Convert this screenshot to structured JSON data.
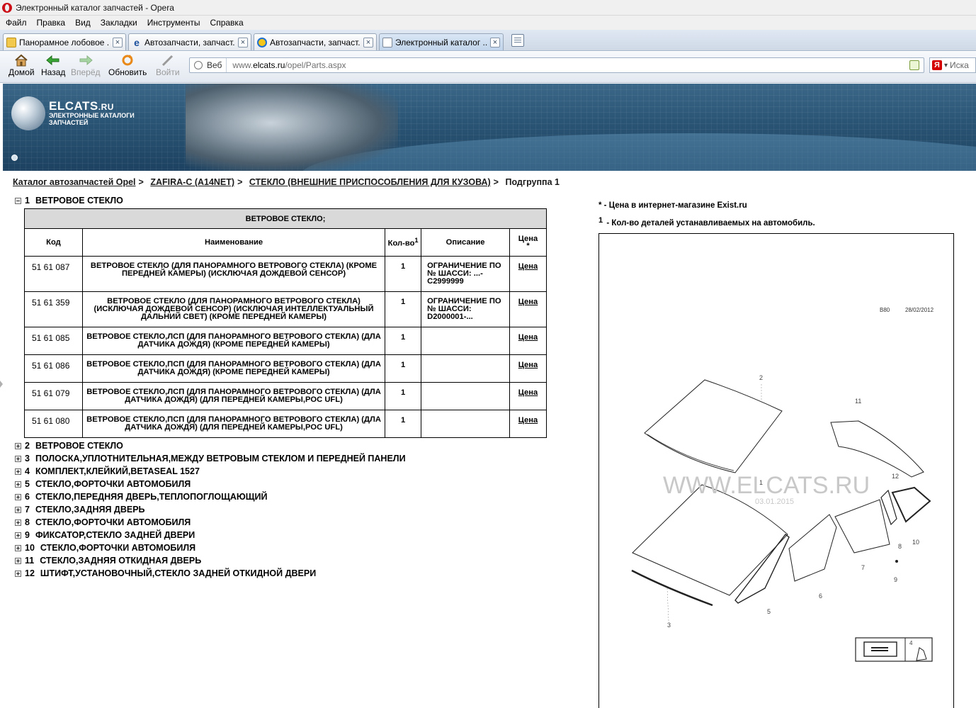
{
  "window": {
    "title": "Электронный каталог запчастей - Opera"
  },
  "menu": [
    "Файл",
    "Правка",
    "Вид",
    "Закладки",
    "Инструменты",
    "Справка"
  ],
  "tabs": [
    {
      "label": "Панорамное лобовое ...",
      "icon": "folder-icon"
    },
    {
      "label": "Автозапчасти, запчаст...",
      "icon": "ie-icon"
    },
    {
      "label": "Автозапчасти, запчаст...",
      "icon": "ie-icon"
    },
    {
      "label": "Электронный каталог ...",
      "icon": "page-icon"
    }
  ],
  "toolbar": {
    "home": "Домой",
    "back": "Назад",
    "forward": "Вперёд",
    "reload": "Обновить",
    "login": "Войти"
  },
  "address": {
    "web_label": "Веб",
    "url_prefix": "www.",
    "url_domain": "elcats.ru",
    "url_path": "/opel/Parts.aspx"
  },
  "search": {
    "placeholder": "Иска"
  },
  "banner": {
    "brand": "ELCATS",
    "brand_suffix": ".RU",
    "subtitle": "ЭЛЕКТРОННЫЕ КАТАЛОГИ ЗАПЧАСТЕЙ"
  },
  "breadcrumb": {
    "catalog": "Каталог автозапчастей Opel",
    "model": "ZAFIRA-C (A14NET)",
    "group": "СТЕКЛО (ВНЕШНИЕ ПРИСПОСОБЛЕНИЯ ДЛЯ КУЗОВА)",
    "current": "Подгруппа 1",
    "separator": ">"
  },
  "expanded_group": {
    "num": "1",
    "label": "ВЕТРОВОЕ СТЕКЛО"
  },
  "table": {
    "caption": "ВЕТРОВОЕ СТЕКЛО;",
    "headers": {
      "code": "Код",
      "name": "Наименование",
      "qty": "Кол-во",
      "qty_sup": "1",
      "desc": "Описание",
      "price": "Цена",
      "price_sup": "*"
    },
    "rows": [
      {
        "code": "51 61 087",
        "name": "ВЕТРОВОЕ СТЕКЛО (ДЛЯ ПАНОРАМНОГО ВЕТРОВОГО СТЕКЛА) (КРОМЕ ПЕРЕДНЕЙ КАМЕРЫ) (ИСКЛЮЧАЯ ДОЖДЕВОЙ СЕНСОР)",
        "qty": "1",
        "desc": "ОГРАНИЧЕНИЕ ПО № ШАССИ: ...-C2999999",
        "price": "Цена"
      },
      {
        "code": "51 61 359",
        "name": "ВЕТРОВОЕ СТЕКЛО (ДЛЯ ПАНОРАМНОГО ВЕТРОВОГО СТЕКЛА) (ИСКЛЮЧАЯ ДОЖДЕВОЙ СЕНСОР) (ИСКЛЮЧАЯ ИНТЕЛЛЕКТУАЛЬНЫЙ ДАЛЬНИЙ СВЕТ) (КРОМЕ ПЕРЕДНЕЙ КАМЕРЫ)",
        "qty": "1",
        "desc": "ОГРАНИЧЕНИЕ ПО № ШАССИ: D2000001-...",
        "price": "Цена"
      },
      {
        "code": "51 61 085",
        "name": "ВЕТРОВОЕ СТЕКЛО,ЛСП (ДЛЯ ПАНОРАМНОГО ВЕТРОВОГО СТЕКЛА) (ДЛА ДАТЧИКА ДОЖДЯ) (КРОМЕ ПЕРЕДНЕЙ КАМЕРЫ)",
        "qty": "1",
        "desc": "",
        "price": "Цена"
      },
      {
        "code": "51 61 086",
        "name": "ВЕТРОВОЕ СТЕКЛО,ПСП (ДЛЯ ПАНОРАМНОГО ВЕТРОВОГО СТЕКЛА) (ДЛА ДАТЧИКА ДОЖДЯ) (КРОМЕ ПЕРЕДНЕЙ КАМЕРЫ)",
        "qty": "1",
        "desc": "",
        "price": "Цена"
      },
      {
        "code": "51 61 079",
        "name": "ВЕТРОВОЕ СТЕКЛО,ЛСП (ДЛЯ ПАНОРАМНОГО ВЕТРОВОГО СТЕКЛА) (ДЛА ДАТЧИКА ДОЖДЯ) (ДЛЯ ПЕРЕДНЕЙ КАМЕРЫ,POC UFL)",
        "qty": "1",
        "desc": "",
        "price": "Цена"
      },
      {
        "code": "51 61 080",
        "name": "ВЕТРОВОЕ СТЕКЛО,ПСП (ДЛЯ ПАНОРАМНОГО ВЕТРОВОГО СТЕКЛА) (ДЛА ДАТЧИКА ДОЖДЯ) (ДЛЯ ПЕРЕДНЕЙ КАМЕРЫ,POC UFL)",
        "qty": "1",
        "desc": "",
        "price": "Цена"
      }
    ]
  },
  "groups": [
    {
      "num": "2",
      "label": "ВЕТРОВОЕ СТЕКЛО"
    },
    {
      "num": "3",
      "label": "ПОЛОСКА,УПЛОТНИТЕЛЬНАЯ,МЕЖДУ ВЕТРОВЫМ СТЕКЛОМ И ПЕРЕДНЕЙ ПАНЕЛИ"
    },
    {
      "num": "4",
      "label": "КОМПЛЕКТ,КЛЕЙКИЙ,BETASEAL 1527"
    },
    {
      "num": "5",
      "label": "СТЕКЛО,ФОРТОЧКИ АВТОМОБИЛЯ"
    },
    {
      "num": "6",
      "label": "СТЕКЛО,ПЕРЕДНЯЯ ДВЕРЬ,ТЕПЛОПОГЛОЩАЮЩИЙ"
    },
    {
      "num": "7",
      "label": "СТЕКЛО,ЗАДНЯЯ ДВЕРЬ"
    },
    {
      "num": "8",
      "label": "СТЕКЛО,ФОРТОЧКИ АВТОМОБИЛЯ"
    },
    {
      "num": "9",
      "label": "ФИКСАТОР,СТЕКЛО ЗАДНЕЙ ДВЕРИ"
    },
    {
      "num": "10",
      "label": "СТЕКЛО,ФОРТОЧКИ АВТОМОБИЛЯ"
    },
    {
      "num": "11",
      "label": "СТЕКЛО,ЗАДНЯЯ ОТКИДНАЯ ДВЕРЬ"
    },
    {
      "num": "12",
      "label": "ШТИФТ,УСТАНОВОЧНЫЙ,СТЕКЛО ЗАДНЕЙ ОТКИДНОЙ ДВЕРИ"
    }
  ],
  "legend": {
    "price_mark": "*",
    "price_note": " - Цена в интернет-магазине Exist.ru",
    "qty_mark": "1",
    "qty_note": " - Кол-во деталей устанавливаемых на автомобиль."
  },
  "diagram": {
    "code": "B80",
    "date": "28/02/2012",
    "watermark": "WWW.ELCATS.RU",
    "watermark_date": "03.01.2015",
    "callouts": [
      "1",
      "2",
      "3",
      "4",
      "5",
      "6",
      "7",
      "8",
      "9",
      "10",
      "11",
      "12"
    ]
  }
}
